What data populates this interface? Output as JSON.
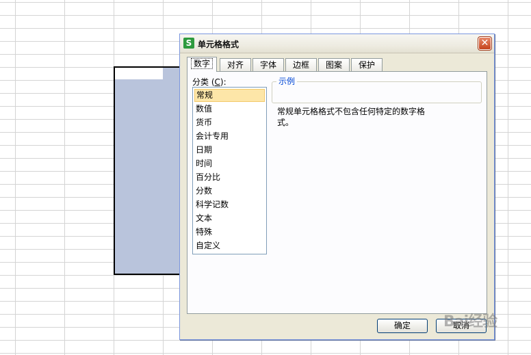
{
  "dialog": {
    "title": "单元格格式",
    "app_icon_letter": "S",
    "close_glyph": "✕",
    "tabs": [
      "数字",
      "对齐",
      "字体",
      "边框",
      "图案",
      "保护"
    ],
    "active_tab": "数字",
    "category_label_prefix": "分类 (",
    "category_label_key": "C",
    "category_label_suffix": "):",
    "categories": [
      "常规",
      "数值",
      "货币",
      "会计专用",
      "日期",
      "时间",
      "百分比",
      "分数",
      "科学记数",
      "文本",
      "特殊",
      "自定义"
    ],
    "selected_category": "常规",
    "sample_label": "示例",
    "description": "常规单元格格式不包含任何特定的数字格式。",
    "ok_label": "确定",
    "cancel_label": "取消"
  },
  "watermark": "Bai经验",
  "colors": {
    "selection_fill": "#b9c4dc",
    "dialog_bg": "#ece9d8",
    "selected_item": "#fde6a8",
    "accent": "#0046d5"
  }
}
